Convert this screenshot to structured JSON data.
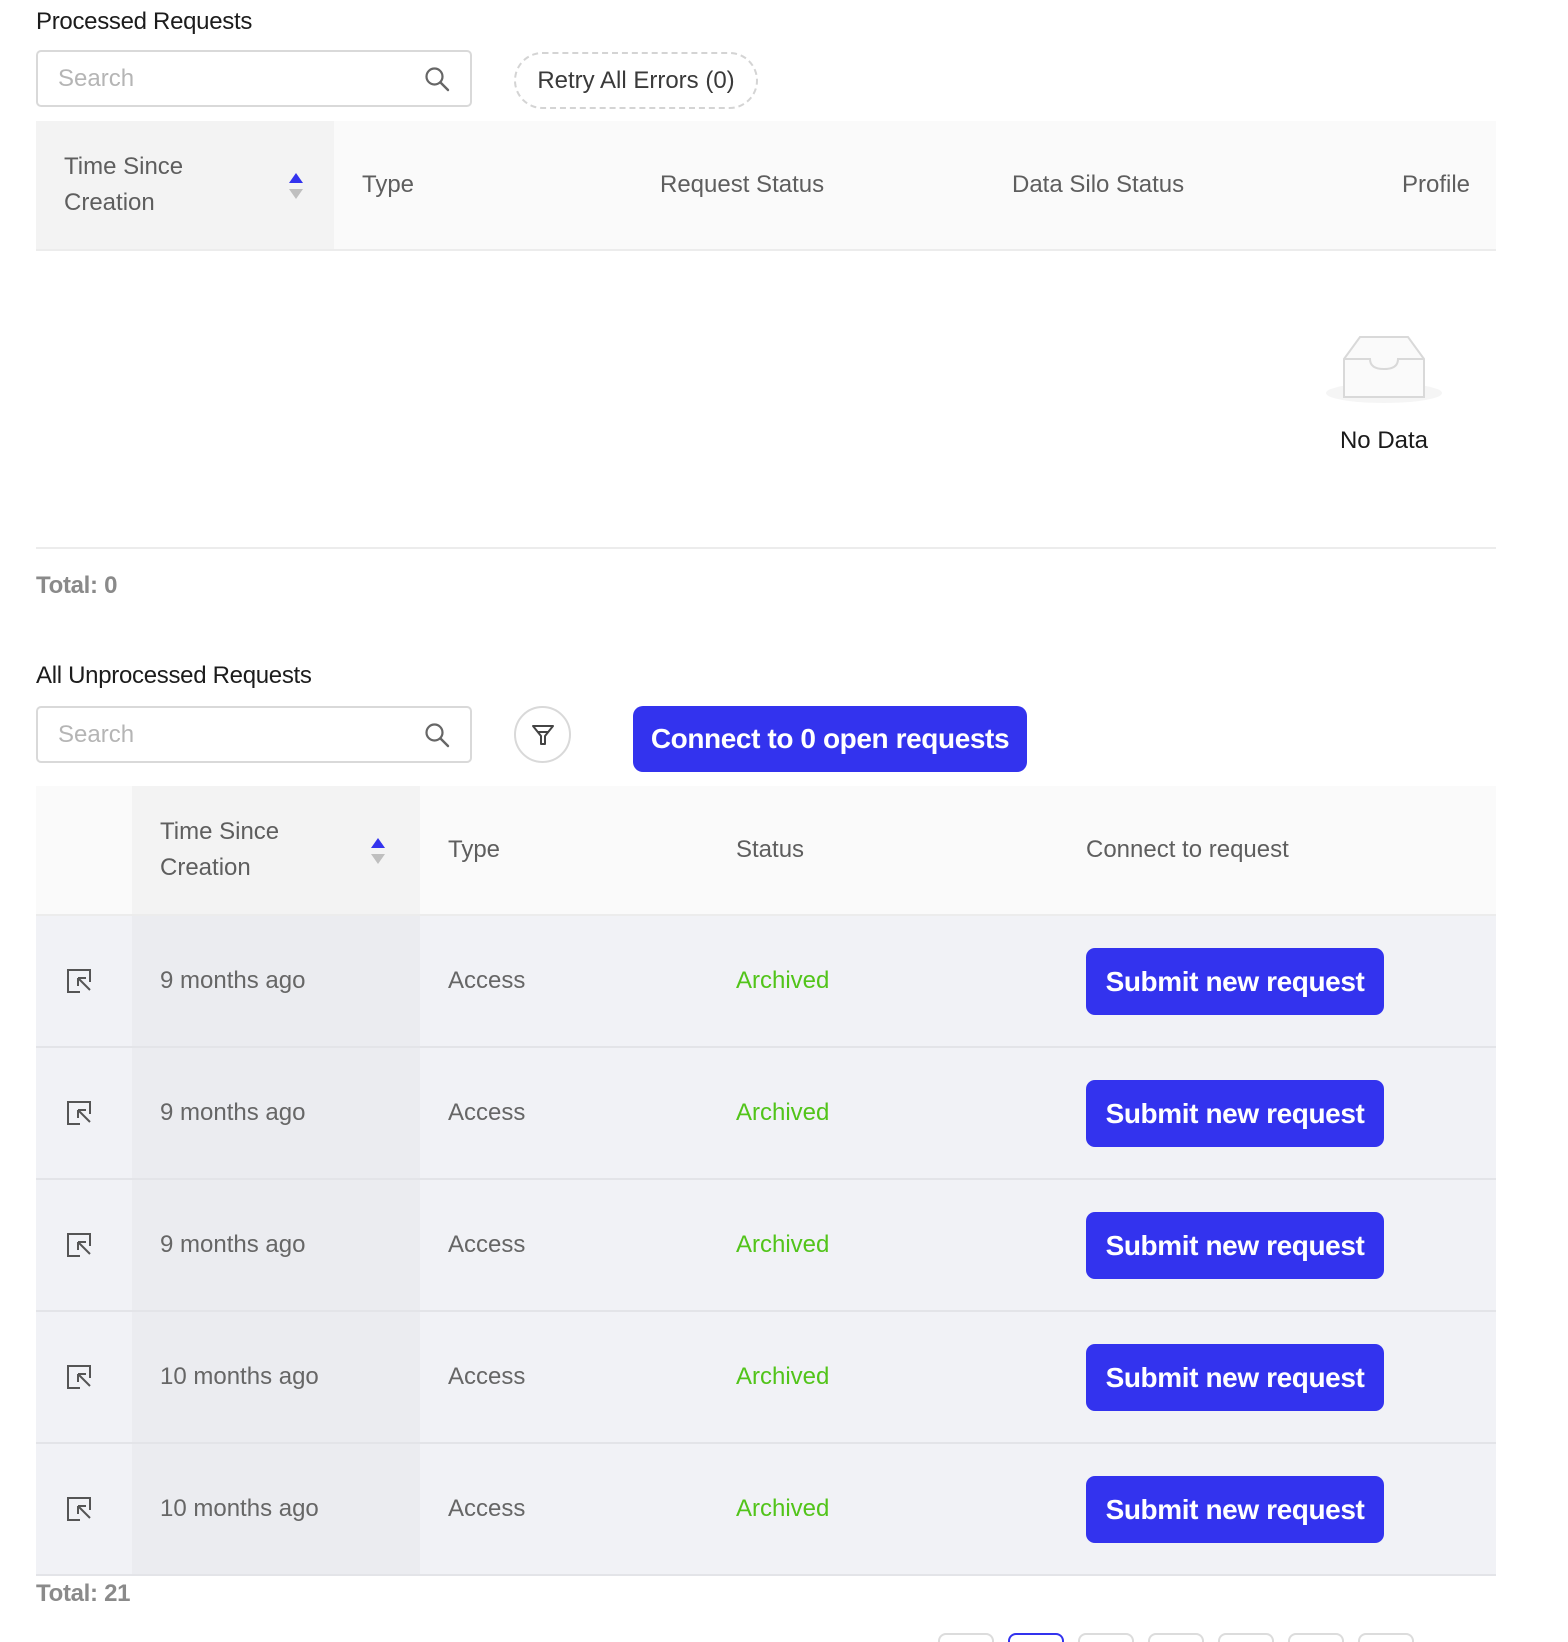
{
  "processed": {
    "title": "Processed Requests",
    "search_placeholder": "Search",
    "retry_label": "Retry All Errors (0)",
    "columns": [
      "Time Since\nCreation",
      "Type",
      "Request Status",
      "Data Silo Status",
      "Profile"
    ],
    "empty_text": "No Data",
    "total": "Total: 0"
  },
  "unprocessed": {
    "title": "All Unprocessed Requests",
    "search_placeholder": "Search",
    "connect_label": "Connect to 0 open requests",
    "columns": [
      "",
      "Time Since\nCreation",
      "Type",
      "Status",
      "Connect to request"
    ],
    "rows": [
      {
        "time": "9 months ago",
        "type": "Access",
        "status": "Archived",
        "action": "Submit new request"
      },
      {
        "time": "9 months ago",
        "type": "Access",
        "status": "Archived",
        "action": "Submit new request"
      },
      {
        "time": "9 months ago",
        "type": "Access",
        "status": "Archived",
        "action": "Submit new request"
      },
      {
        "time": "10 months ago",
        "type": "Access",
        "status": "Archived",
        "action": "Submit new request"
      },
      {
        "time": "10 months ago",
        "type": "Access",
        "status": "Archived",
        "action": "Submit new request"
      }
    ],
    "total": "Total: 21"
  },
  "colors": {
    "accent": "#3333ee",
    "status_archived": "#52c41a",
    "sort_active": "#3333ee"
  }
}
